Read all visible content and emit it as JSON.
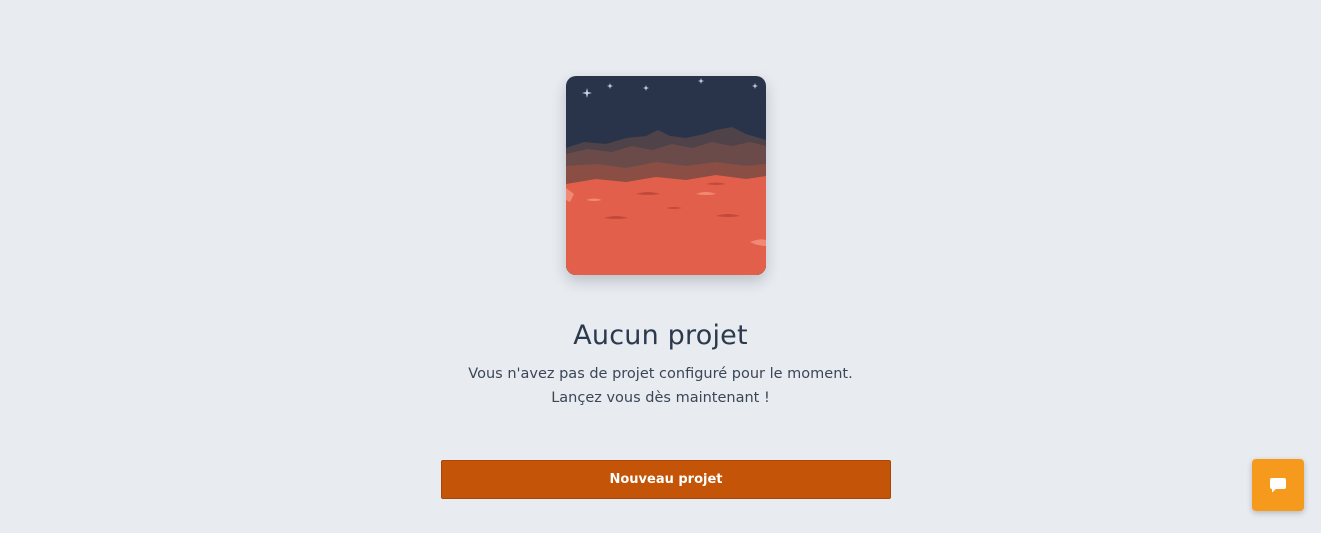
{
  "empty_state": {
    "title": "Aucun projet",
    "description_line1": "Vous n'avez pas de projet configuré pour le moment.",
    "description_line2": "Lançez vous dès maintenant !",
    "cta_label": "Nouveau projet",
    "illustration": "mars-landscape-illustration"
  },
  "chat_widget": {
    "icon": "chat-bubble-icon"
  },
  "colors": {
    "background": "#e8ebf0",
    "title_text": "#2b3a4d",
    "body_text": "#3b4656",
    "cta_background": "#c45408",
    "chat_button": "#f69a1e",
    "sky": "#29344a",
    "ground": "#e25f4b"
  }
}
